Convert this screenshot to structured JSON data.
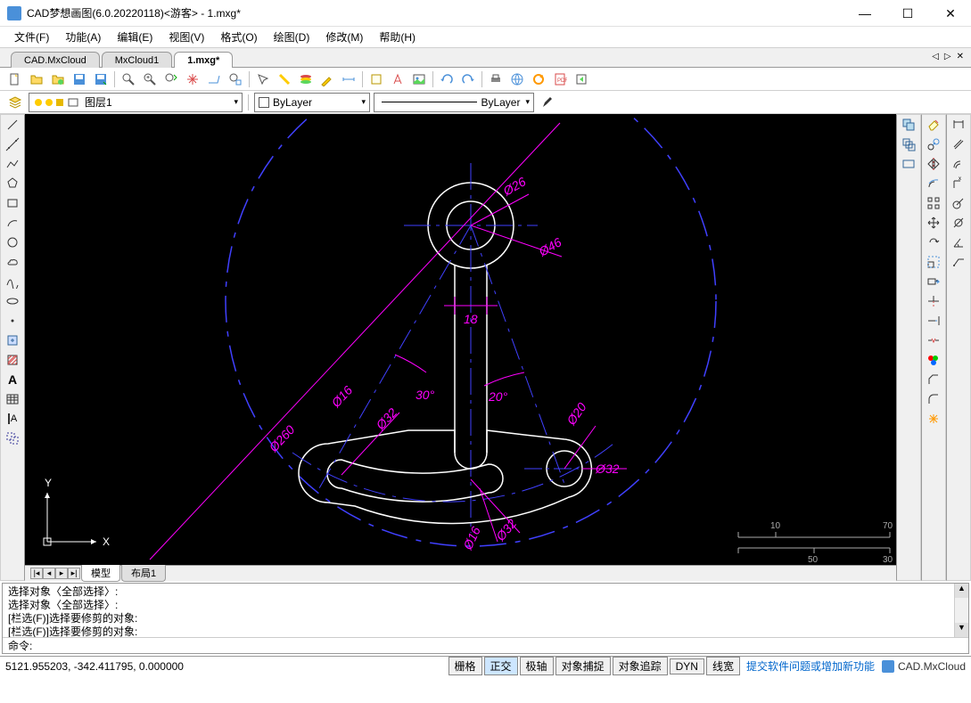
{
  "title": "CAD梦想画图(6.0.20220118)<游客>  -  1.mxg*",
  "menus": [
    "文件(F)",
    "功能(A)",
    "编辑(E)",
    "视图(V)",
    "格式(O)",
    "绘图(D)",
    "修改(M)",
    "帮助(H)"
  ],
  "tabs": {
    "items": [
      "CAD.MxCloud",
      "MxCloud1",
      "1.mxg*"
    ],
    "active": 2
  },
  "layer": {
    "current": "图层1",
    "colorLabel": "ByLayer",
    "linetypeLabel": "ByLayer"
  },
  "layoutTabs": {
    "items": [
      "模型",
      "布局1"
    ],
    "active": 0
  },
  "cmdHistory": [
    "选择对象〈全部选择〉:",
    "选择对象〈全部选择〉:",
    "[栏选(F)]选择要修剪的对象:",
    "[栏选(F)]选择要修剪的对象:"
  ],
  "cmdPrompt": "命令:",
  "status": {
    "coords": "5121.955203,  -342.411795,  0.000000",
    "toggles": [
      {
        "label": "栅格",
        "active": false
      },
      {
        "label": "正交",
        "active": true
      },
      {
        "label": "极轴",
        "active": false
      },
      {
        "label": "对象捕捉",
        "active": false
      },
      {
        "label": "对象追踪",
        "active": false
      },
      {
        "label": "DYN",
        "active": false
      },
      {
        "label": "线宽",
        "active": false
      }
    ],
    "link": "提交软件问题或增加新功能",
    "brand": "CAD.MxCloud"
  },
  "drawing": {
    "dimensions": {
      "d26": "Ø26",
      "d46": "Ø46",
      "l18": "18",
      "a30": "30°",
      "a20": "20°",
      "d16l": "Ø16",
      "d260": "Ø260",
      "d32l": "Ø32",
      "d20r": "Ø20",
      "d32r": "Ø32",
      "d16b": "Ø16",
      "d32b": "Ø32"
    },
    "ucs": {
      "x": "X",
      "y": "Y"
    },
    "ruler": {
      "v1": "10",
      "v2": "70",
      "v3": "50",
      "v4": "30"
    }
  }
}
